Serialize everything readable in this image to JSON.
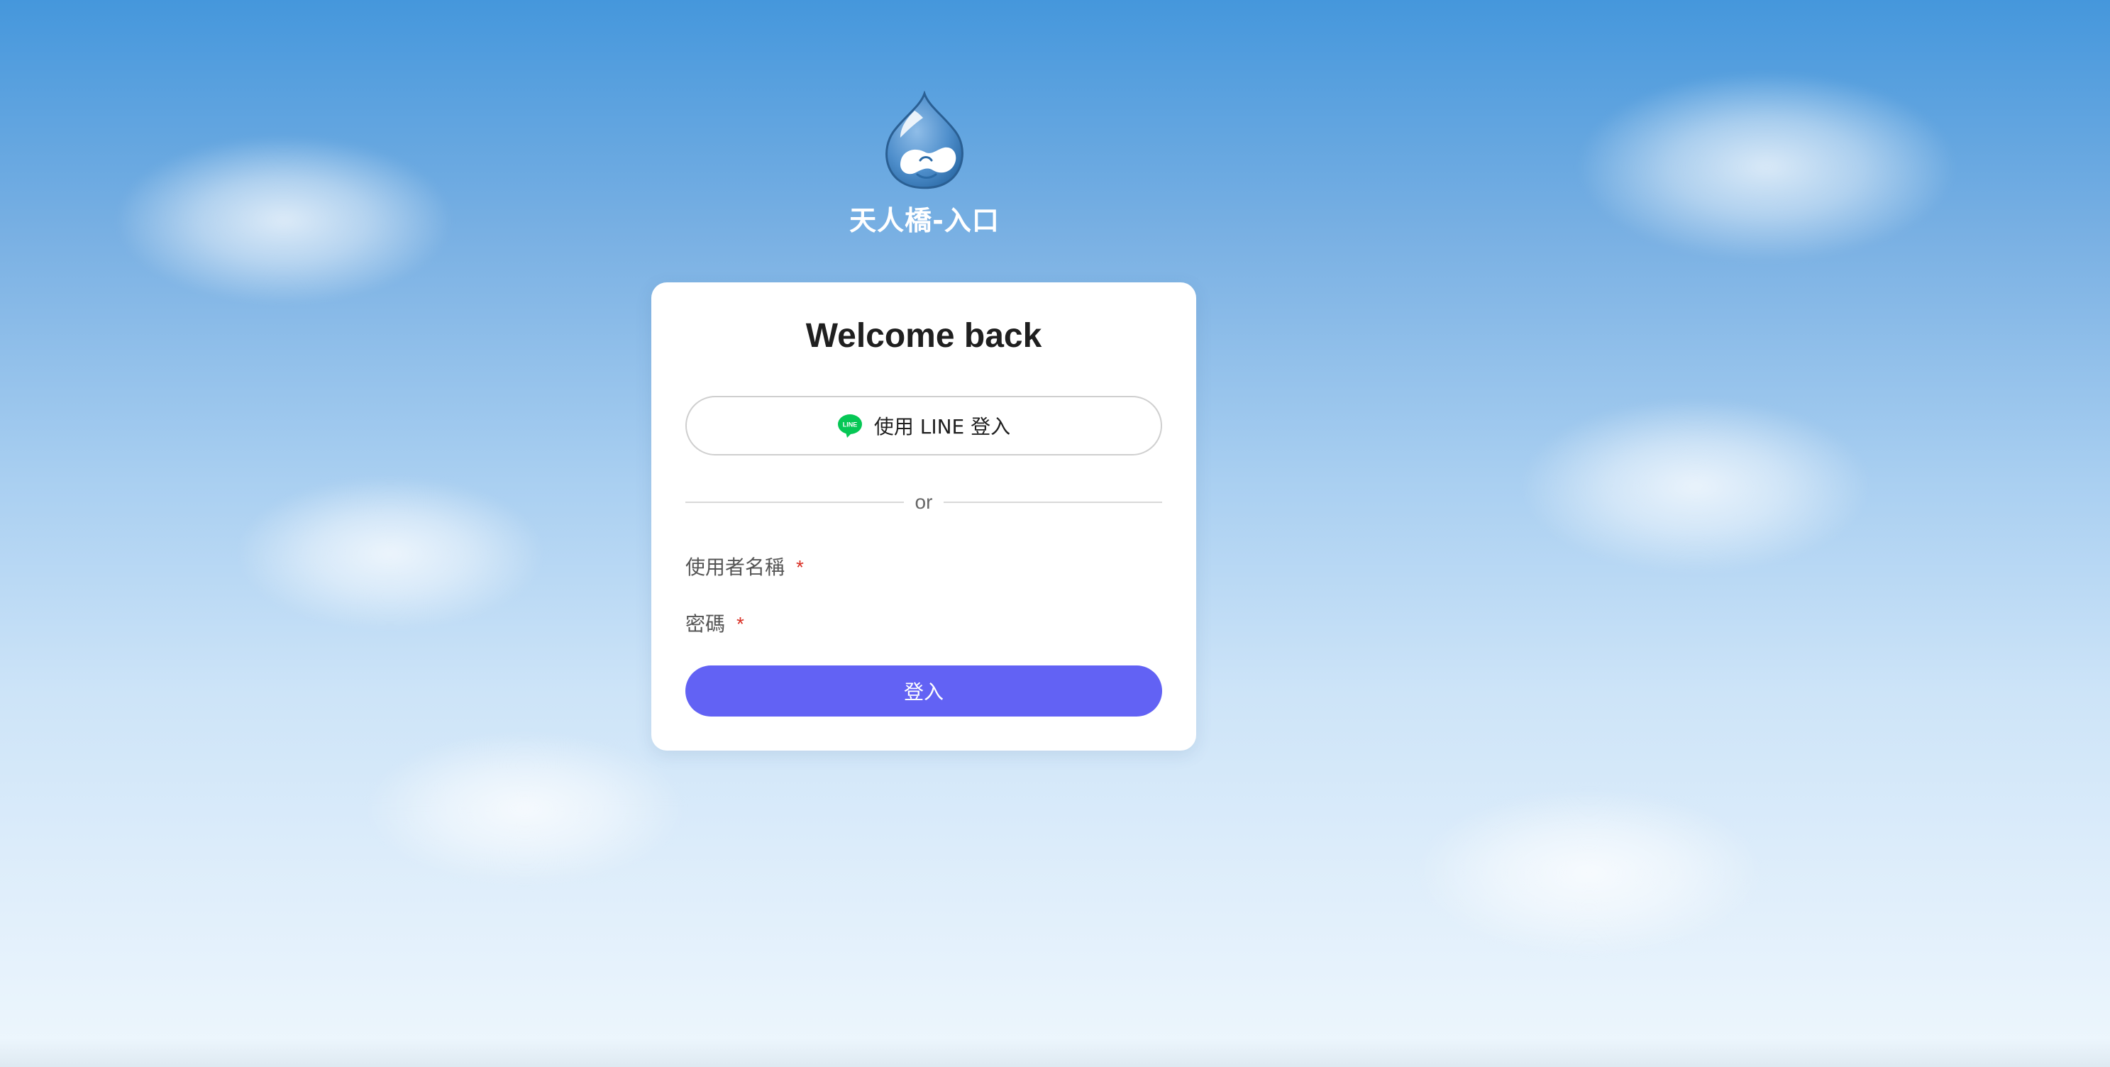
{
  "site": {
    "name": "天人橋-入口"
  },
  "card": {
    "title": "Welcome back",
    "line_login_label": "使用 LINE 登入",
    "line_icon_text": "LINE",
    "divider_text": "or",
    "username_label": "使用者名稱",
    "password_label": "密碼",
    "required_mark": "*",
    "submit_label": "登入"
  },
  "colors": {
    "primary_button": "#6262f4",
    "line_green": "#06c755",
    "required": "#d93025"
  },
  "icons": {
    "logo": "drupal-drop-logo",
    "line": "line-icon"
  }
}
